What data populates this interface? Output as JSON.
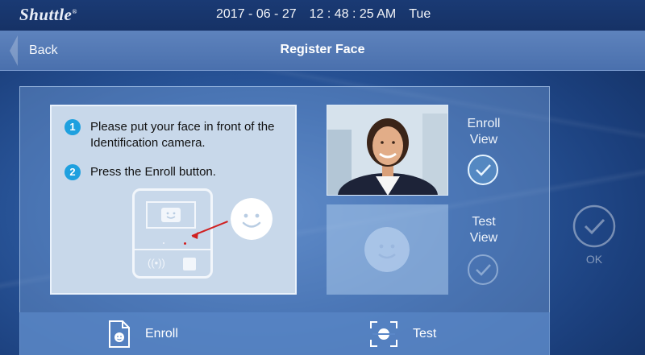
{
  "topbar": {
    "brand": "Shuttle",
    "brand_mark": "®",
    "date": "2017 - 06 - 27",
    "time": "12 : 48 : 25 AM",
    "weekday": "Tue"
  },
  "header": {
    "back_label": "Back",
    "title": "Register Face"
  },
  "instructions": {
    "steps": [
      {
        "number": "1",
        "text": "Please put your face in front of the Identification camera."
      },
      {
        "number": "2",
        "text": "Press the Enroll button."
      }
    ]
  },
  "views": {
    "enroll_label_line1": "Enroll",
    "enroll_label_line2": "View",
    "test_label_line1": "Test",
    "test_label_line2": "View"
  },
  "ok": {
    "label": "OK"
  },
  "bottom": {
    "enroll_label": "Enroll",
    "test_label": "Test"
  },
  "colors": {
    "accent_blue": "#1ea0df",
    "pointer_red": "#d02020"
  },
  "icons": [
    "back-arrow-icon",
    "step-number-icon",
    "device-icon",
    "smiley-icon",
    "check-icon",
    "ok-check-icon",
    "enroll-file-icon",
    "face-scan-icon"
  ]
}
